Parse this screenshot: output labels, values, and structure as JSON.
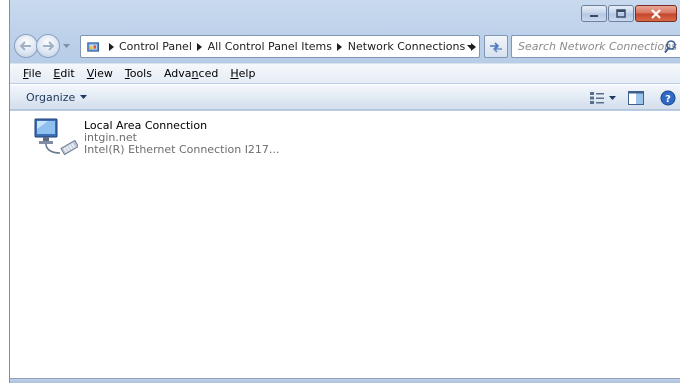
{
  "window": {
    "caption_buttons": [
      "minimize",
      "maximize",
      "close"
    ]
  },
  "address_bar": {
    "crumbs": [
      "Control Panel",
      "All Control Panel Items",
      "Network Connections"
    ],
    "search_placeholder": "Search Network Connections"
  },
  "menu": {
    "file": {
      "key": "F",
      "rest": "ile"
    },
    "edit": {
      "key": "E",
      "rest": "dit"
    },
    "view": {
      "key": "V",
      "rest": "iew"
    },
    "tools": {
      "key": "T",
      "rest": "ools"
    },
    "advanced": {
      "pre": "Adva",
      "key": "n",
      "rest": "ced"
    },
    "help": {
      "key": "H",
      "rest": "elp"
    }
  },
  "command_bar": {
    "organize_label": "Organize"
  },
  "connections": [
    {
      "name": "Local Area Connection",
      "network": "intgin.net",
      "adapter": "Intel(R) Ethernet Connection I217..."
    }
  ],
  "icons": {
    "back": "back-arrow-icon",
    "forward": "forward-arrow-icon",
    "refresh": "refresh-icon",
    "search": "search-icon",
    "views": "change-view-icon",
    "preview_pane": "preview-pane-icon",
    "help": "help-icon",
    "connection": "network-adapter-icon"
  }
}
